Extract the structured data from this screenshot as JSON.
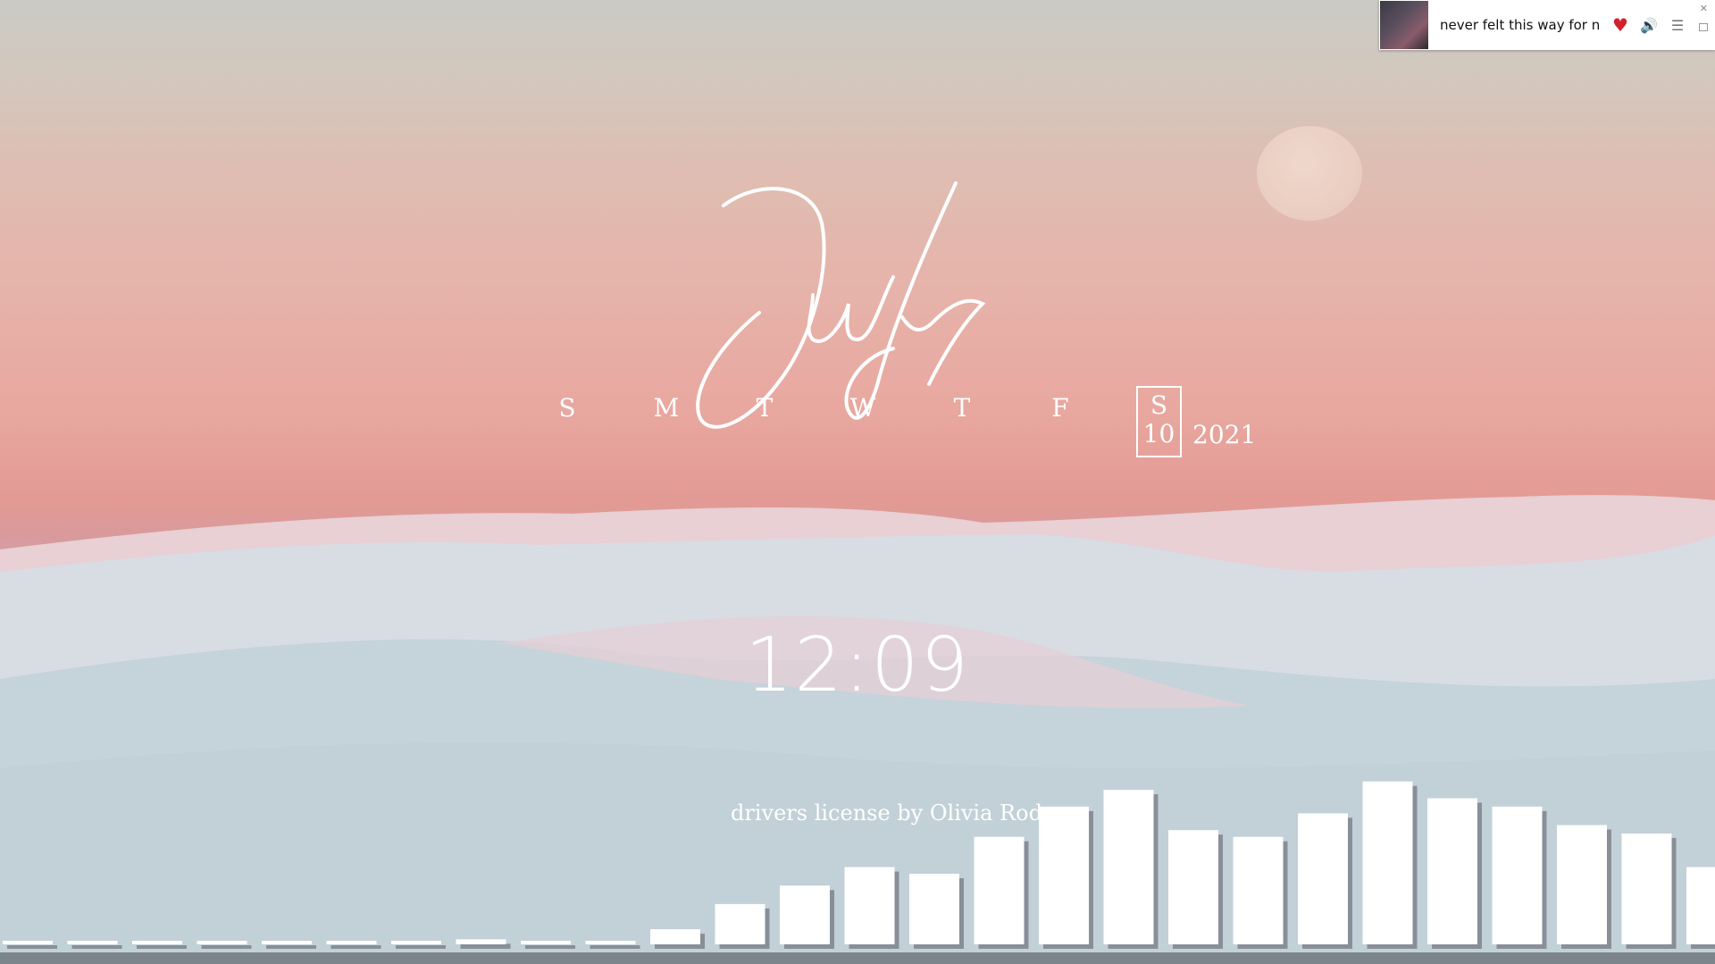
{
  "music_widget": {
    "song_title": "never felt this way for nc",
    "icons": [
      "heart-icon",
      "volume-icon",
      "list-icon",
      "close-icon",
      "minimize-icon"
    ],
    "heart_color": "#d3212c"
  },
  "calendar": {
    "month": "July",
    "weekdays": [
      "S",
      "M",
      "T",
      "W",
      "T",
      "F",
      "S"
    ],
    "current_day_letter": "S",
    "current_day_number": "10",
    "year": "2021"
  },
  "clock": {
    "time": "12:09"
  },
  "now_playing": {
    "text": "drivers license by Olivia Rodr"
  },
  "visualizer": {
    "bar_color": "#ffffff",
    "levels": [
      0.01,
      0.01,
      0.01,
      0.01,
      0.01,
      0.02,
      0.02,
      0.03,
      0.02,
      0.02,
      0.09,
      0.24,
      0.35,
      0.46,
      0.42,
      0.64,
      0.82,
      0.92,
      0.68,
      0.64,
      0.78,
      0.97,
      0.87,
      0.82,
      0.71,
      0.66,
      0.46
    ]
  }
}
